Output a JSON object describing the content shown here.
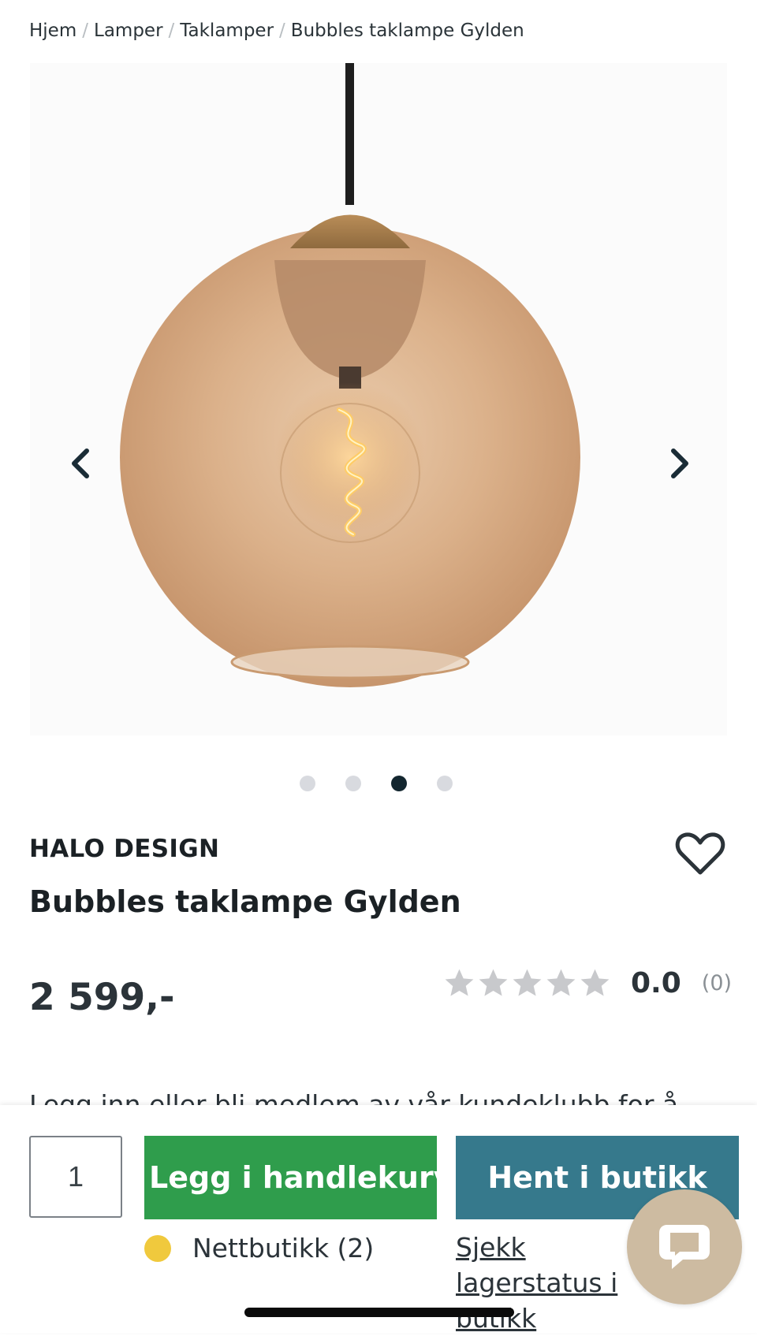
{
  "breadcrumb": {
    "items": [
      "Hjem",
      "Lamper",
      "Taklamper",
      "Bubbles taklampe Gylden"
    ],
    "separator": "/"
  },
  "gallery": {
    "image_count": 4,
    "active_index": 2,
    "prev_icon": "chevron-left-icon",
    "next_icon": "chevron-right-icon"
  },
  "product": {
    "brand": "HALO DESIGN",
    "title": "Bubbles taklampe Gylden",
    "price": "2 599,-",
    "rating_value": "0.0",
    "rating_count": "(0)",
    "stars_filled": 0,
    "stars_total": 5
  },
  "teaser": "Legg inn eller bli medlem av vår kundeklubb for å",
  "purchase": {
    "quantity": "1",
    "add_to_cart": "Legg i handlekurv",
    "pickup": "Hent i butikk",
    "stock_label": "Nettbutikk (2)",
    "check_stock_link": "Sjekk lagerstatus i butikk"
  },
  "colors": {
    "cart_button": "#2f9d4c",
    "pickup_button": "#36798c",
    "stock_dot": "#f0c93d",
    "chat_bubble": "#cdbba1",
    "dot_active": "#13262f",
    "dot_inactive": "#d8dadf",
    "star_empty": "#c8c9cc"
  },
  "icons": {
    "favorite": "heart-outline-icon",
    "chat": "chat-bubble-icon"
  }
}
